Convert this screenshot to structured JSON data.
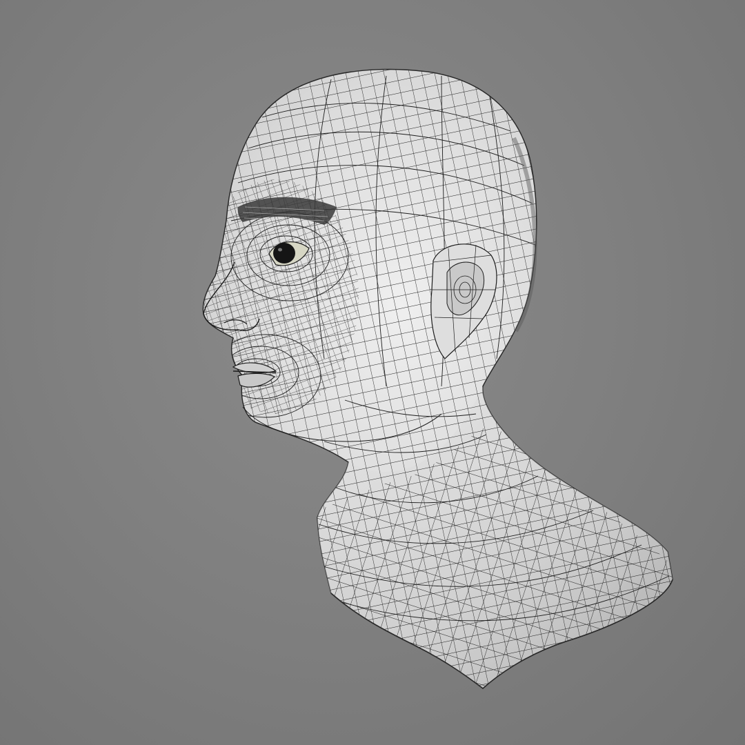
{
  "scene": {
    "subject": "head-bust-wireframe",
    "colors": {
      "background": "#7f7f7f",
      "surface_light": "#e8e8e8",
      "surface_mid": "#cdcdcd",
      "surface_shadow": "#a9a9a9",
      "wire": "#1c1c1c",
      "eye": "#151515",
      "brow": "#3a3a3a"
    }
  }
}
